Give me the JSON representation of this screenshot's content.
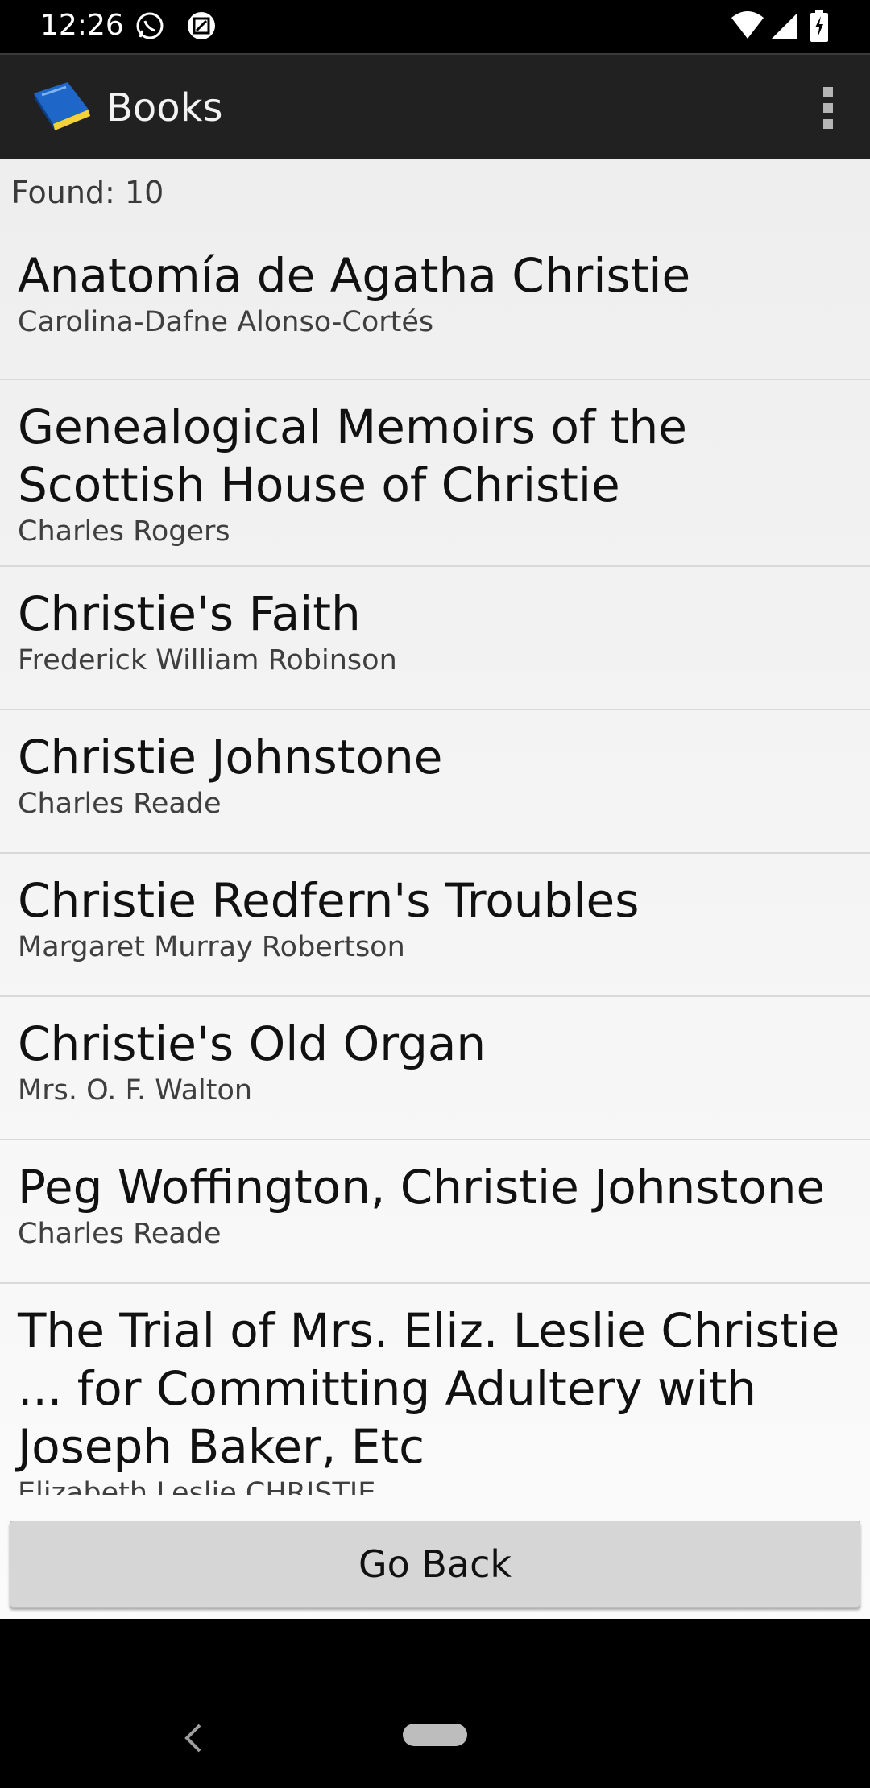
{
  "status_bar": {
    "time": "12:26",
    "icons": [
      "whatsapp-icon",
      "screenshot-icon",
      "wifi-icon",
      "signal-icon",
      "battery-charging-icon"
    ]
  },
  "app_bar": {
    "title": "Books",
    "logo_icon": "book-logo-icon",
    "menu_icon": "overflow-menu-icon"
  },
  "results": {
    "found_label": "Found: 10"
  },
  "books": [
    {
      "title": "Anatomía de Agatha Christie",
      "author": "Carolina-Dafne Alonso-Cortés"
    },
    {
      "title": "Genealogical Memoirs of the Scottish House of Christie",
      "author": "Charles Rogers"
    },
    {
      "title": "Christie's Faith",
      "author": "Frederick William Robinson"
    },
    {
      "title": "Christie Johnstone",
      "author": "Charles Reade"
    },
    {
      "title": "Christie Redfern's Troubles",
      "author": "Margaret Murray Robertson"
    },
    {
      "title": "Christie's Old Organ",
      "author": "Mrs. O. F. Walton"
    },
    {
      "title": "Peg Woffington, Christie Johnstone",
      "author": "Charles Reade"
    },
    {
      "title": "The Trial of Mrs. Eliz. Leslie Christie ... for Committing Adultery with Joseph Baker, Etc",
      "author": "Elizabeth Leslie CHRISTIE"
    }
  ],
  "footer": {
    "go_back_label": "Go Back"
  },
  "colors": {
    "app_bar": "#212121",
    "content_bg": "#eeeeee",
    "button_bg": "#d6d6d6"
  }
}
